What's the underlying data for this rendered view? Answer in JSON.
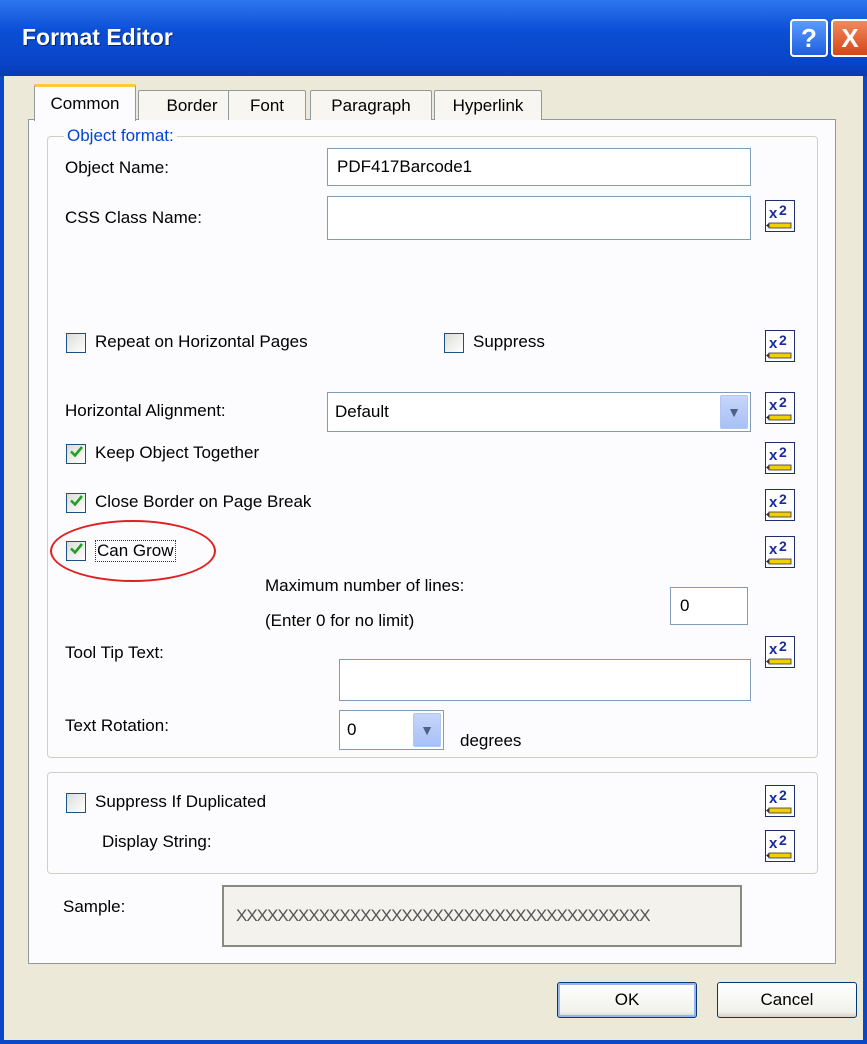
{
  "window": {
    "title": "Format Editor",
    "help_glyph": "?",
    "close_glyph": "X"
  },
  "tabs": [
    {
      "label": "Common",
      "active": true
    },
    {
      "label": "Border"
    },
    {
      "label": "Font"
    },
    {
      "label": "Paragraph"
    },
    {
      "label": "Hyperlink"
    }
  ],
  "object_format": {
    "legend": "Object format:",
    "object_name_label": "Object Name:",
    "object_name_value": "PDF417Barcode1",
    "css_class_label": "CSS Class Name:",
    "css_class_value": "",
    "repeat_label": "Repeat on Horizontal Pages",
    "repeat_checked": false,
    "suppress_label": "Suppress",
    "suppress_checked": false,
    "halign_label": "Horizontal Alignment:",
    "halign_value": "Default",
    "keep_together_label": "Keep Object Together",
    "keep_together_checked": true,
    "close_border_label": "Close Border on Page Break",
    "close_border_checked": true,
    "can_grow_label": "Can Grow",
    "can_grow_checked": true,
    "max_lines_label": "Maximum number of lines:",
    "max_lines_hint": "(Enter 0 for no limit)",
    "max_lines_value": "0",
    "tooltip_label": "Tool Tip Text:",
    "tooltip_value": "",
    "rotation_label": "Text Rotation:",
    "rotation_value": "0",
    "rotation_unit": "degrees"
  },
  "duplicate_group": {
    "suppress_dup_label": "Suppress If Duplicated",
    "suppress_dup_checked": false,
    "display_string_label": "Display String:"
  },
  "sample": {
    "label": "Sample:",
    "value": "XXXXXXXXXXXXXXXXXXXXXXXXXXXXXXXXXXXXXXXX"
  },
  "buttons": {
    "ok": "OK",
    "cancel": "Cancel"
  },
  "colors": {
    "titlebar": "#0844c7",
    "legend_text": "#0046d5",
    "highlight_ring": "#e02020",
    "tab_accent": "#ffc83c"
  },
  "icons": {
    "formula_button": "formula-x2-icon",
    "checkmark": "checkmark-icon",
    "dropdown": "chevron-down-icon"
  }
}
